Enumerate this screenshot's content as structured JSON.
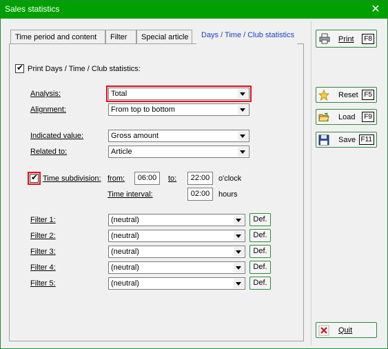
{
  "window": {
    "title": "Sales statistics",
    "close_glyph": "✕"
  },
  "tabs": [
    {
      "label": "Time period and content"
    },
    {
      "label": "Filter"
    },
    {
      "label": "Special article"
    },
    {
      "label": "Days / Time / Club statistics",
      "active": true
    }
  ],
  "print_days": {
    "label": "Print Days / Time / Club statistics:",
    "checked": true
  },
  "analysis": {
    "label": "Analysis:",
    "value": "Total"
  },
  "alignment": {
    "label": "Alignment:",
    "value": "From top to bottom"
  },
  "indicated_value": {
    "label": "Indicated value:",
    "value": "Gross amount"
  },
  "related_to": {
    "label": "Related to:",
    "value": "Article"
  },
  "time_subdivision": {
    "label": "Time subdivision:",
    "checked": true,
    "from_label": "from:",
    "from_value": "06:00",
    "to_label": "to:",
    "to_value": "22:00",
    "oclock_label": "o'clock",
    "interval_label": "Time interval:",
    "interval_value": "02:00",
    "hours_label": "hours"
  },
  "filters": [
    {
      "label": "Filter 1:",
      "value": "(neutral)",
      "def": "Def."
    },
    {
      "label": "Filter 2:",
      "value": "(neutral)",
      "def": "Def."
    },
    {
      "label": "Filter 3:",
      "value": "(neutral)",
      "def": "Def."
    },
    {
      "label": "Filter 4:",
      "value": "(neutral)",
      "def": "Def."
    },
    {
      "label": "Filter 5:",
      "value": "(neutral)",
      "def": "Def."
    }
  ],
  "side_buttons": {
    "print": {
      "label": "Print",
      "key": "F8",
      "icon": "printer-icon"
    },
    "reset": {
      "label": "Reset",
      "key": "F5",
      "icon": "star-icon"
    },
    "load": {
      "label": "Load",
      "key": "F9",
      "icon": "folder-open-icon"
    },
    "save": {
      "label": "Save",
      "key": "F11",
      "icon": "floppy-disk-icon"
    },
    "quit": {
      "label": "Quit",
      "icon": "close-x-icon"
    }
  },
  "colors": {
    "titlebar": "#00a000",
    "active_tab_text": "#1a3ec8",
    "highlight": "#e0101c",
    "button_border": "#2f8a3c"
  }
}
